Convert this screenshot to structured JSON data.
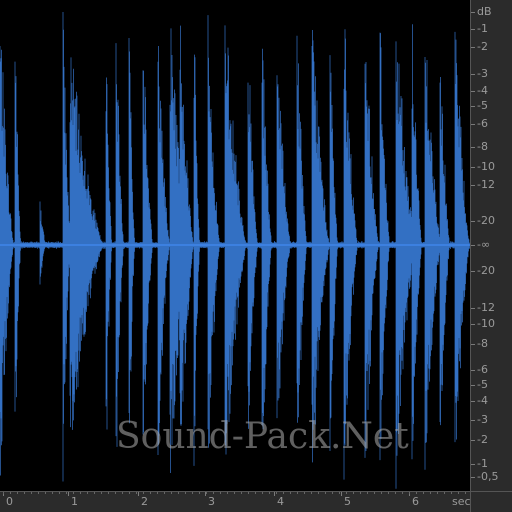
{
  "editor": {
    "waveform_color": "#3f86ea",
    "background_color": "#000000",
    "ruler_background": "#2b2b2b",
    "ruler_text_color": "#9a9a9a"
  },
  "db_ruler": {
    "unit": "dB",
    "labels": [
      "dB",
      "-1",
      "-2",
      "-3",
      "-4",
      "-5",
      "-6",
      "-8",
      "-10",
      "-12",
      "-20",
      "-∞",
      "-20",
      "-12",
      "-10",
      "-8",
      "-6",
      "-5",
      "-4",
      "-3",
      "-2",
      "-1",
      "-0,5"
    ]
  },
  "time_ruler": {
    "unit": "sec",
    "labels": [
      "0",
      "1",
      "2",
      "3",
      "4",
      "5",
      "6",
      "sec"
    ]
  },
  "watermark": {
    "text": "Sound-Pack.Net"
  }
}
